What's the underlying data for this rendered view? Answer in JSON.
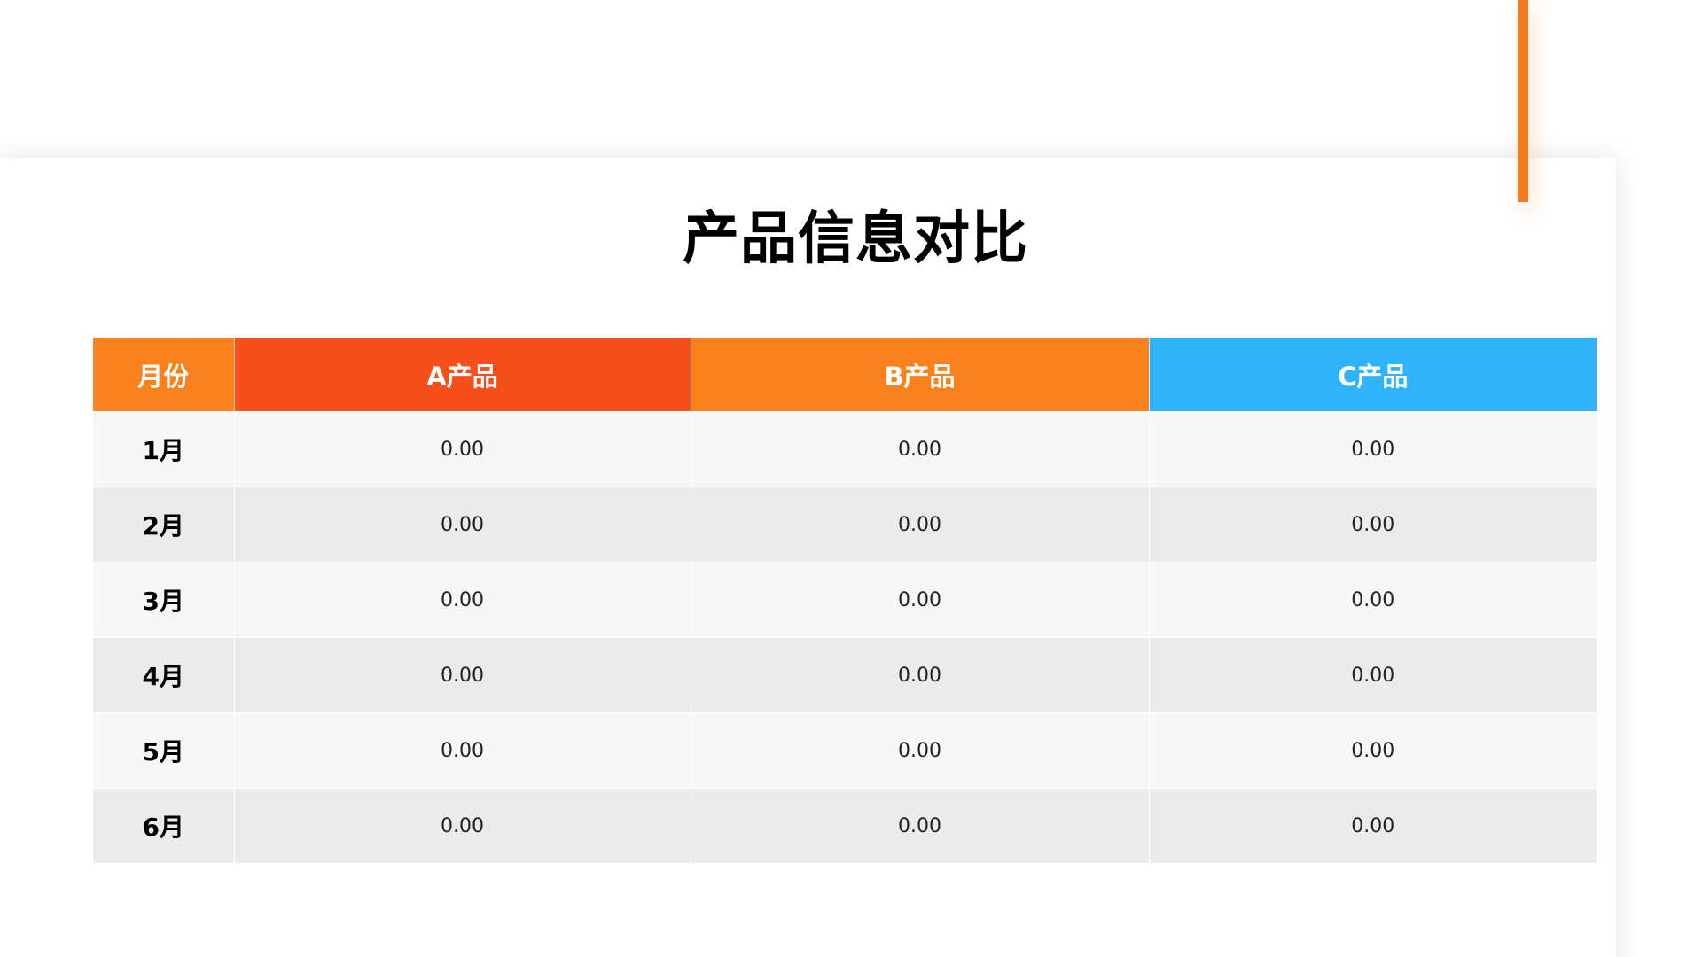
{
  "title": "产品信息对比",
  "colors": {
    "accent_bar": "#f47a20",
    "month_header": "#f7821e",
    "product_a_header": "#f5501b",
    "product_b_header": "#f7821e",
    "product_c_header": "#2fb4f9",
    "row_light": "#f7f7f7",
    "row_dark": "#ebebeb"
  },
  "table": {
    "headers": [
      "月份",
      "A产品",
      "B产品",
      "C产品"
    ],
    "rows": [
      {
        "month": "1月",
        "a": "0.00",
        "b": "0.00",
        "c": "0.00"
      },
      {
        "month": "2月",
        "a": "0.00",
        "b": "0.00",
        "c": "0.00"
      },
      {
        "month": "3月",
        "a": "0.00",
        "b": "0.00",
        "c": "0.00"
      },
      {
        "month": "4月",
        "a": "0.00",
        "b": "0.00",
        "c": "0.00"
      },
      {
        "month": "5月",
        "a": "0.00",
        "b": "0.00",
        "c": "0.00"
      },
      {
        "month": "6月",
        "a": "0.00",
        "b": "0.00",
        "c": "0.00"
      }
    ]
  }
}
